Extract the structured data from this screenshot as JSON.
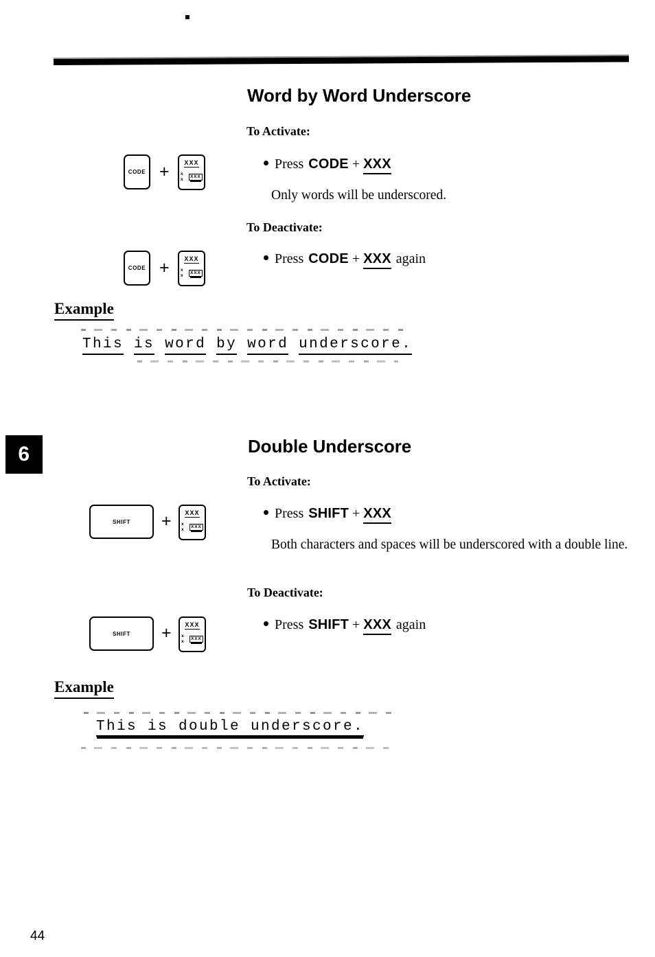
{
  "page": {
    "number": "44",
    "chapter_tab": "6"
  },
  "sections": [
    {
      "title": "Word by Word Underscore",
      "activate_heading": "To Activate:",
      "activate_bullet": {
        "press": "Press",
        "key1": "CODE",
        "plus": "+",
        "key2": "XXX",
        "suffix": ""
      },
      "activate_note": "Only words will be underscored.",
      "deactivate_heading": "To Deactivate:",
      "deactivate_bullet": {
        "press": "Press",
        "key1": "CODE",
        "plus": "+",
        "key2": "XXX",
        "suffix": "again"
      },
      "example_label": "Example",
      "example_words": [
        "This",
        "is",
        "word",
        "by",
        "word",
        "underscore."
      ],
      "keycap_label": "CODE",
      "xkey_top": "XXX",
      "xkey_bottom_plain": "x x",
      "xkey_bottom_boxed": "XXX"
    },
    {
      "title": "Double Underscore",
      "activate_heading": "To Activate:",
      "activate_bullet": {
        "press": "Press",
        "key1": "SHIFT",
        "plus": "+",
        "key2": "XXX",
        "suffix": ""
      },
      "activate_note": "Both characters and spaces will be underscored with a double line.",
      "deactivate_heading": "To Deactivate:",
      "deactivate_bullet": {
        "press": "Press",
        "key1": "SHIFT",
        "plus": "+",
        "key2": "XXX",
        "suffix": "again"
      },
      "example_label": "Example",
      "example_text": "This is double underscore.",
      "keycap_label": "SHIFT",
      "xkey_top": "XXX",
      "xkey_bottom_plain": "x x",
      "xkey_bottom_boxed": "XXX"
    }
  ],
  "symbols": {
    "plus": "+"
  },
  "colors": {
    "ink": "#000000",
    "paper": "#ffffff"
  }
}
